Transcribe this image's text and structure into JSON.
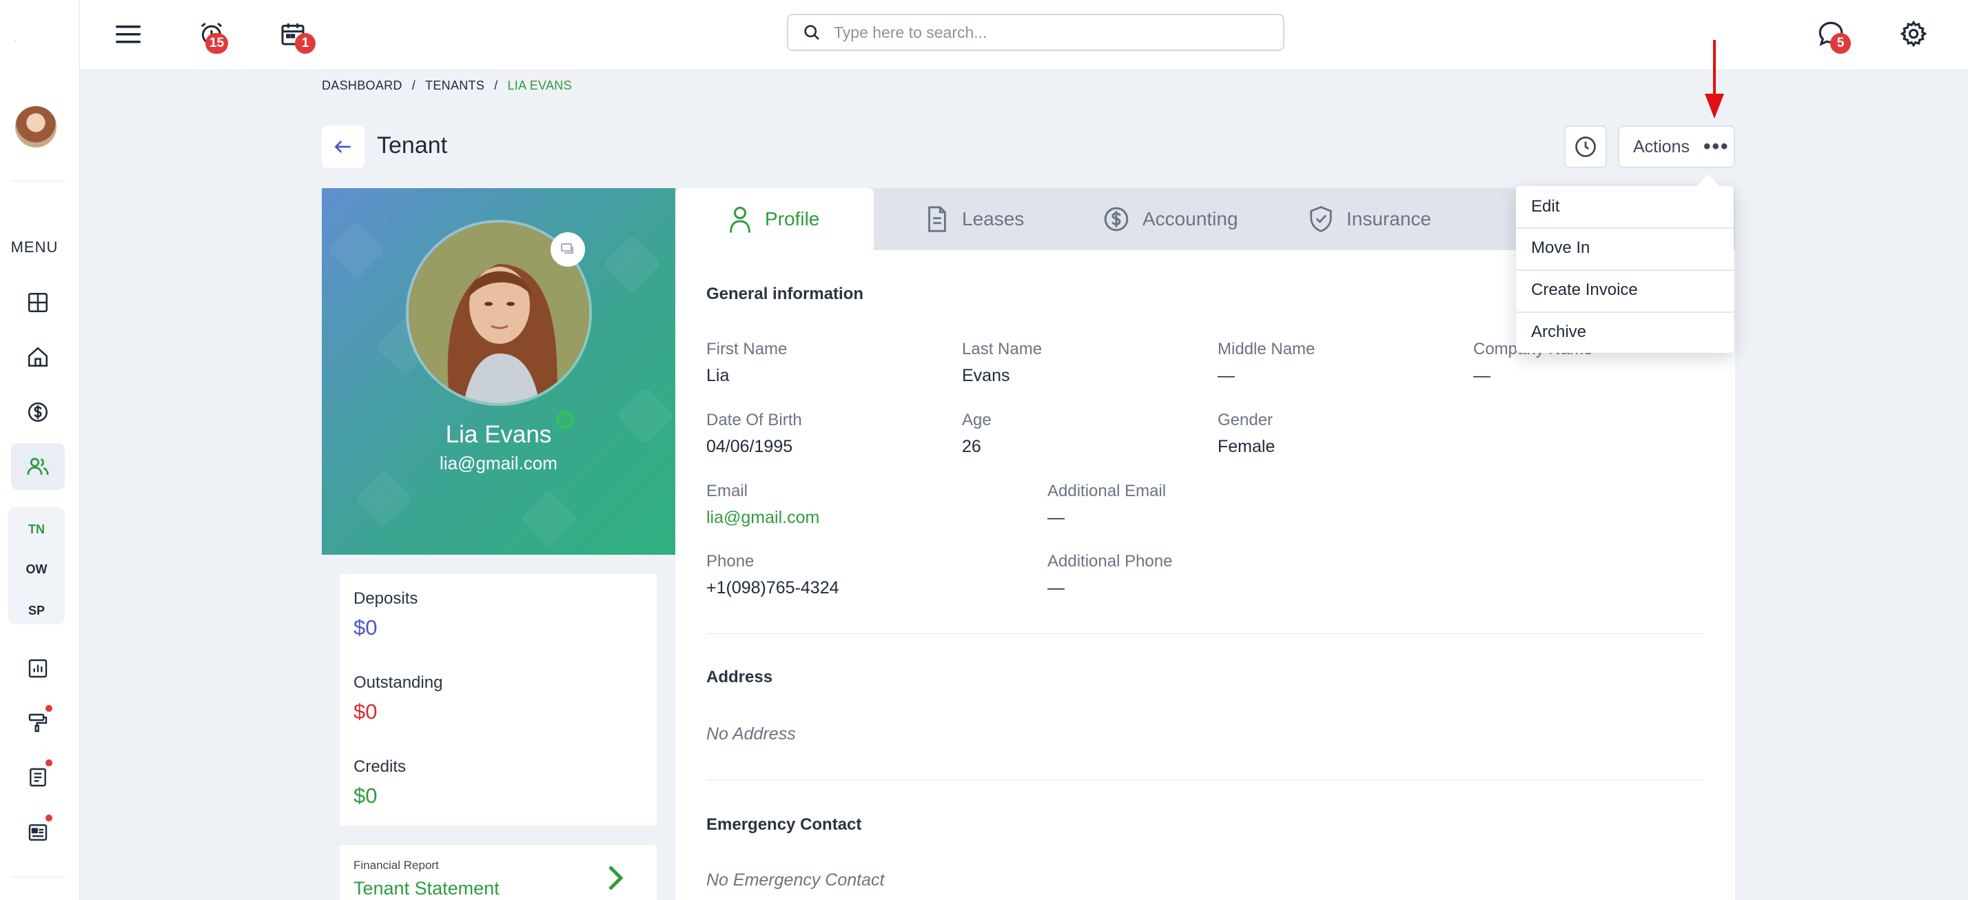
{
  "sidebar": {
    "menu_label": "MENU",
    "sub_items": [
      {
        "label": "TN"
      },
      {
        "label": "OW"
      },
      {
        "label": "SP"
      }
    ]
  },
  "topbar": {
    "search_placeholder": "Type here to search...",
    "alarm_badge": "15",
    "calendar_badge": "1",
    "chat_badge": "5"
  },
  "breadcrumb": {
    "items": [
      "DASHBOARD",
      "TENANTS",
      "LIA EVANS"
    ],
    "separator": "/"
  },
  "header": {
    "title": "Tenant",
    "actions_label": "Actions",
    "actions_dots": "•••"
  },
  "dropdown": {
    "items": [
      "Edit",
      "Move In",
      "Create Invoice",
      "Archive"
    ]
  },
  "profile": {
    "name": "Lia Evans",
    "email": "lia@gmail.com"
  },
  "stats": {
    "deposits_label": "Deposits",
    "deposits_value": "$0",
    "outstanding_label": "Outstanding",
    "outstanding_value": "$0",
    "credits_label": "Credits",
    "credits_value": "$0"
  },
  "report": {
    "small": "Financial Report",
    "big": "Tenant Statement"
  },
  "tabs": [
    "Profile",
    "Leases",
    "Accounting",
    "Insurance"
  ],
  "general": {
    "title": "General information",
    "first_name_label": "First Name",
    "first_name": "Lia",
    "last_name_label": "Last Name",
    "last_name": "Evans",
    "middle_name_label": "Middle Name",
    "middle_name": "—",
    "company_name_label": "Company Name",
    "company_name": "—",
    "dob_label": "Date Of Birth",
    "dob": "04/06/1995",
    "age_label": "Age",
    "age": "26",
    "gender_label": "Gender",
    "gender": "Female",
    "email_label": "Email",
    "email": "lia@gmail.com",
    "add_email_label": "Additional Email",
    "add_email": "—",
    "phone_label": "Phone",
    "phone": "+1(098)765-4324",
    "add_phone_label": "Additional Phone",
    "add_phone": "—"
  },
  "address": {
    "title": "Address",
    "empty": "No Address"
  },
  "emergency": {
    "title": "Emergency Contact",
    "empty": "No Emergency Contact"
  },
  "colors": {
    "accent_green": "#2e9c3e",
    "deposits_blue": "#4a56c9",
    "outstanding_red": "#d43030",
    "badge_red": "#e03a3a"
  }
}
